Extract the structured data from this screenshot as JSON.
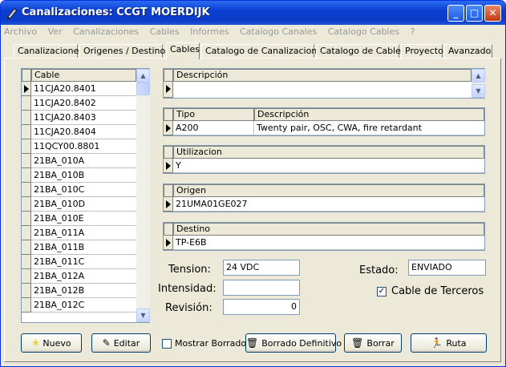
{
  "window": {
    "title": "Canalizaciones: CCGT MOERDIJK",
    "minimize": "_",
    "maximize": "□",
    "close": "✕"
  },
  "menu": [
    "Archivo",
    "Ver",
    "Canalizaciones",
    "Cables",
    "Informes",
    "Catalogo Canales",
    "Catalogo Cables",
    "?"
  ],
  "tabs": [
    "Canalizaciones",
    "Origenes / Destinos",
    "Cables",
    "Catalogo de Canalizaciones",
    "Catalogo de Cables",
    "Proyecto",
    "Avanzado"
  ],
  "cable_list": {
    "header": "Cable",
    "rows": [
      "11CJA20.8401",
      "11CJA20.8402",
      "11CJA20.8403",
      "11CJA20.8404",
      "11QCY00.8801",
      "21BA_010A",
      "21BA_010B",
      "21BA_010C",
      "21BA_010D",
      "21BA_010E",
      "21BA_011A",
      "21BA_011B",
      "21BA_011C",
      "21BA_012A",
      "21BA_012B",
      "21BA_012C"
    ]
  },
  "descripcion": {
    "header": "Descripción",
    "value": ""
  },
  "tipo": {
    "header_tipo": "Tipo",
    "header_desc": "Descripción",
    "tipo": "A200",
    "descripcion": "Twenty pair, OSC, CWA, fire retardant"
  },
  "utilizacion": {
    "header": "Utilizacion",
    "value": "Y"
  },
  "origen": {
    "header": "Origen",
    "value": "21UMA01GE027"
  },
  "destino": {
    "header": "Destino",
    "value": "TP-E6B"
  },
  "tension": {
    "label": "Tension:",
    "value": "24 VDC"
  },
  "intensidad": {
    "label": "Intensidad:",
    "value": ""
  },
  "revision": {
    "label": "Revisión:",
    "value": "0"
  },
  "estado": {
    "label": "Estado:",
    "value": "ENVIADO"
  },
  "cable_terceros": {
    "label": "Cable de Terceros",
    "checked": true,
    "mark": "✓"
  },
  "buttons": {
    "nuevo": "Nuevo",
    "editar": "Editar",
    "mostrar_borrados": "Mostrar Borrados",
    "borrado_definitivo": "Borrado Definitivo",
    "borrar": "Borrar",
    "ruta": "Ruta"
  },
  "colors": {
    "titlebar": "#0a3fd0",
    "face": "#ece9d8",
    "border": "#7f9db9"
  }
}
